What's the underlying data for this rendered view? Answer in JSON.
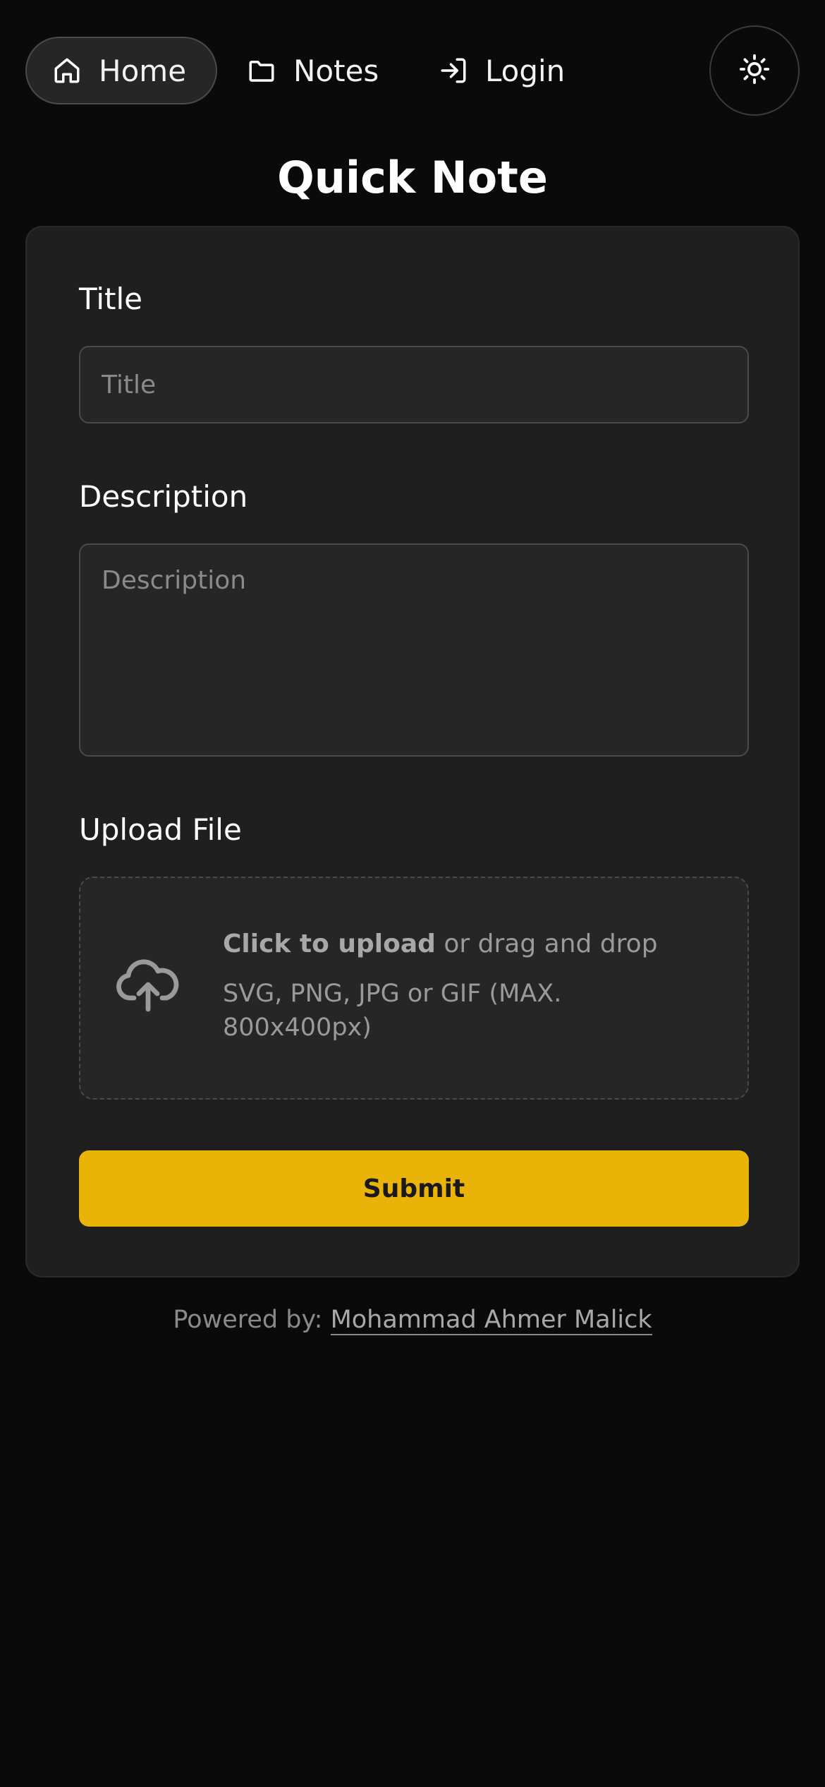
{
  "nav": {
    "items": [
      {
        "label": "Home",
        "icon": "home-icon",
        "active": true
      },
      {
        "label": "Notes",
        "icon": "folder-icon",
        "active": false
      },
      {
        "label": "Login",
        "icon": "login-icon",
        "active": false
      }
    ],
    "theme_toggle_icon": "sun-icon"
  },
  "page": {
    "title": "Quick Note"
  },
  "form": {
    "title_label": "Title",
    "title_placeholder": "Title",
    "title_value": "",
    "description_label": "Description",
    "description_placeholder": "Description",
    "description_value": "",
    "upload_label": "Upload File",
    "upload_click_text": "Click to upload",
    "upload_drag_text": " or drag and drop",
    "upload_hint": "SVG, PNG, JPG or GIF (MAX. 800x400px)",
    "upload_icon": "cloud-upload-icon",
    "submit_label": "Submit"
  },
  "footer": {
    "prefix": "Powered by: ",
    "author": "Mohammad Ahmer Malick"
  },
  "colors": {
    "background": "#0a0a0a",
    "card": "#1f1f1f",
    "input": "#262626",
    "accent": "#eab308"
  }
}
